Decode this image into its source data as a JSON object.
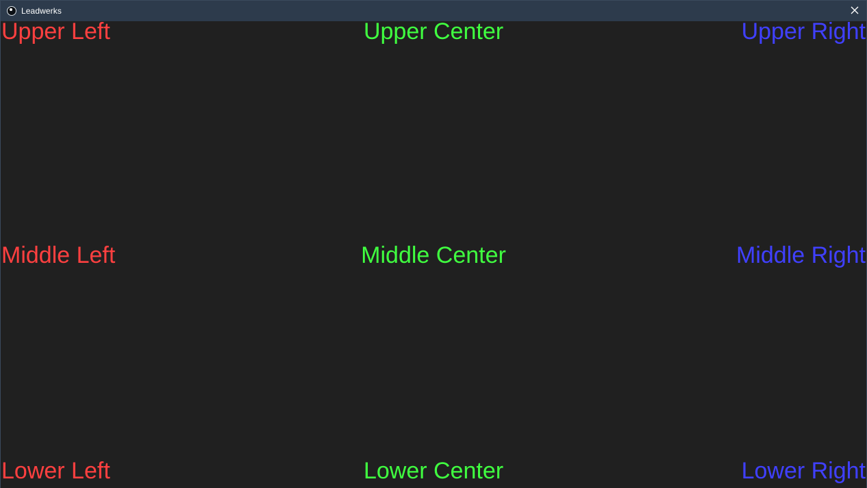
{
  "window": {
    "title": "Leadwerks",
    "app_icon": "leadwerks-logo-icon",
    "close_icon": "close-icon"
  },
  "colors": {
    "left": "#ff4040",
    "center": "#40ff40",
    "right": "#4040ff",
    "background": "#202020",
    "titlebar": "#2d3b4c"
  },
  "labels": {
    "upper_left": "Upper Left",
    "upper_center": "Upper Center",
    "upper_right": "Upper Right",
    "middle_left": "Middle Left",
    "middle_center": "Middle Center",
    "middle_right": "Middle Right",
    "lower_left": "Lower Left",
    "lower_center": "Lower Center",
    "lower_right": "Lower Right"
  }
}
